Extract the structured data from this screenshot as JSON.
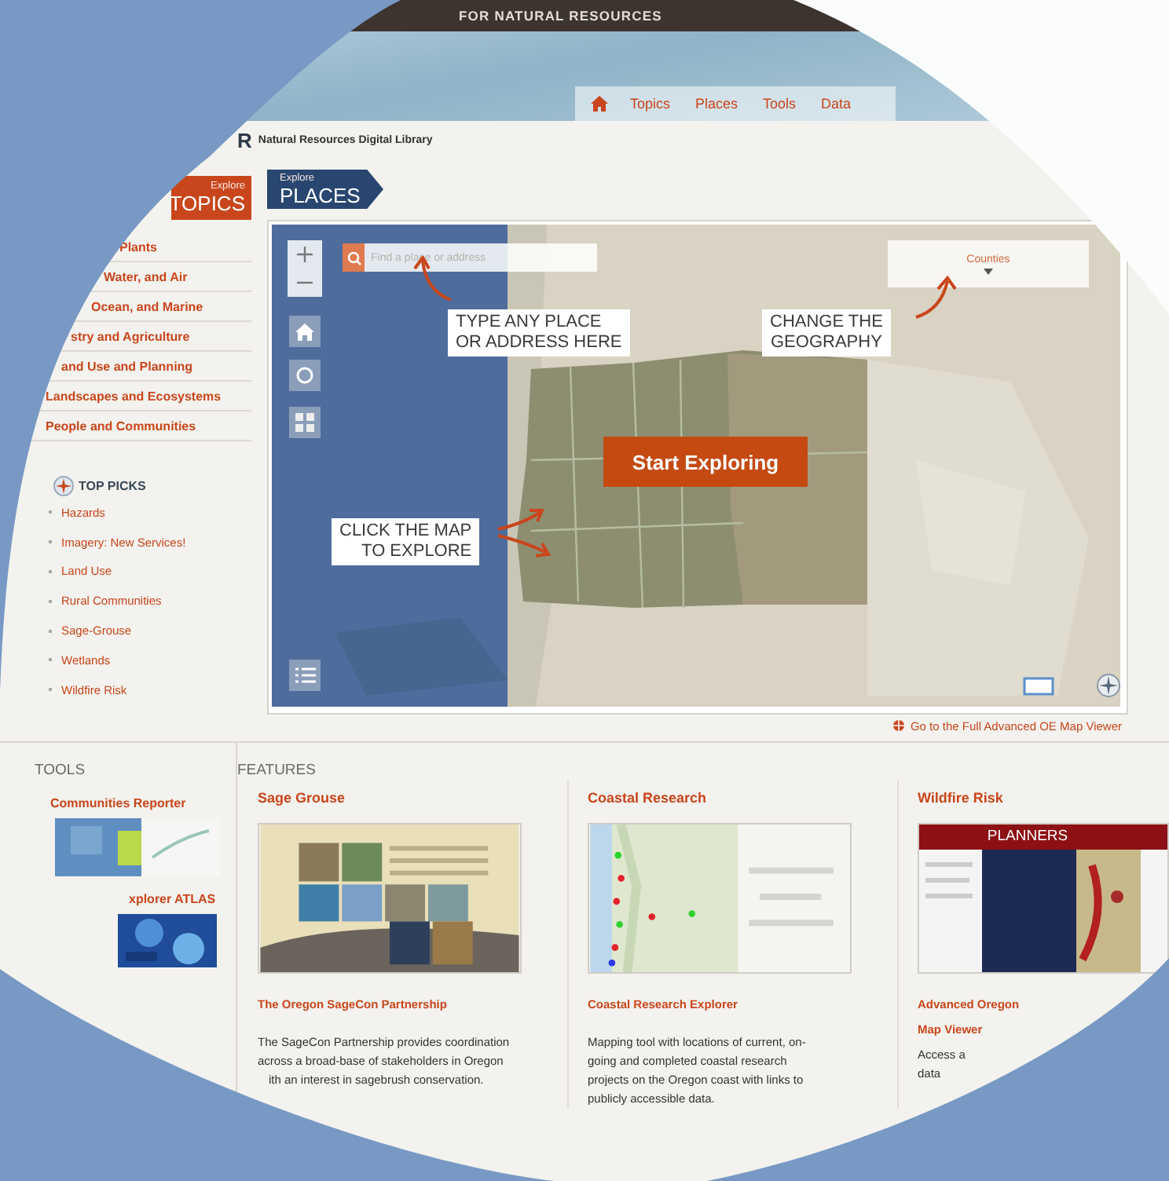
{
  "banner": {
    "title": "FOR NATURAL RESOURCES"
  },
  "nav": {
    "tabs": [
      {
        "label": "Topics",
        "selected": false
      },
      {
        "label": "Places",
        "selected": false
      },
      {
        "label": "Tools",
        "selected": false
      },
      {
        "label": "Data",
        "selected": false
      }
    ]
  },
  "logo": {
    "mark": "R",
    "subtitle": "Natural Resources Digital Library"
  },
  "topics_panel": {
    "eyebrow": "Explore",
    "title": "TOPICS",
    "items": [
      "Plants",
      "Water, and Air",
      "Ocean, and Marine",
      "stry and Agriculture",
      "and Use and Planning",
      "Landscapes and Ecosystems",
      "People and Communities"
    ]
  },
  "top_picks": {
    "title": "TOP PICKS",
    "items": [
      "Hazards",
      "Imagery: New Services!",
      "Land Use",
      "Rural Communities",
      "Sage-Grouse",
      "Wetlands",
      "Wildfire Risk"
    ]
  },
  "places_panel": {
    "eyebrow": "Explore",
    "title": "PLACES"
  },
  "map": {
    "search": {
      "placeholder": "Find a place or address"
    },
    "geography": {
      "value": "Counties"
    },
    "callouts": [
      {
        "kind": "search",
        "text": "TYPE ANY PLACE\nOR ADDRESS HERE"
      },
      {
        "kind": "geography",
        "text": "CHANGE THE\nGEOGRAPHY"
      },
      {
        "kind": "map",
        "text": "CLICK THE MAP\nTO EXPLORE"
      }
    ],
    "start_button": "Start Exploring"
  },
  "map_link": "Go to the Full Advanced OE Map Viewer",
  "tools": {
    "heading": "TOOLS",
    "items": [
      {
        "title": "Communities Reporter"
      },
      {
        "title": "xplorer ATLAS"
      }
    ]
  },
  "features": {
    "heading": "FEATURES",
    "cards": [
      {
        "title": "Sage Grouse",
        "image": {
          "kind": "picture"
        },
        "link": [
          "The Oregon SageCon Partnership"
        ],
        "description": [
          "The SageCon Partnership provides coordination",
          "across a broad-base of stakeholders in Oregon",
          "ith an interest in sagebrush conservation."
        ]
      },
      {
        "title": "Coastal Research",
        "image": {
          "kind": "picture"
        },
        "link": [
          "Coastal Research Explorer"
        ],
        "description": [
          "Mapping tool with locations of current, on-",
          "going and completed coastal research",
          "projects on the Oregon coast with links to",
          "publicly accessible data."
        ]
      },
      {
        "title": "Wildfire Risk",
        "image": {
          "kind": "screenshot",
          "banner": "PLANNERS"
        },
        "link": [
          "Advanced Oregon",
          "Map Viewer"
        ],
        "description": [
          "Access a",
          "data"
        ]
      }
    ]
  }
}
